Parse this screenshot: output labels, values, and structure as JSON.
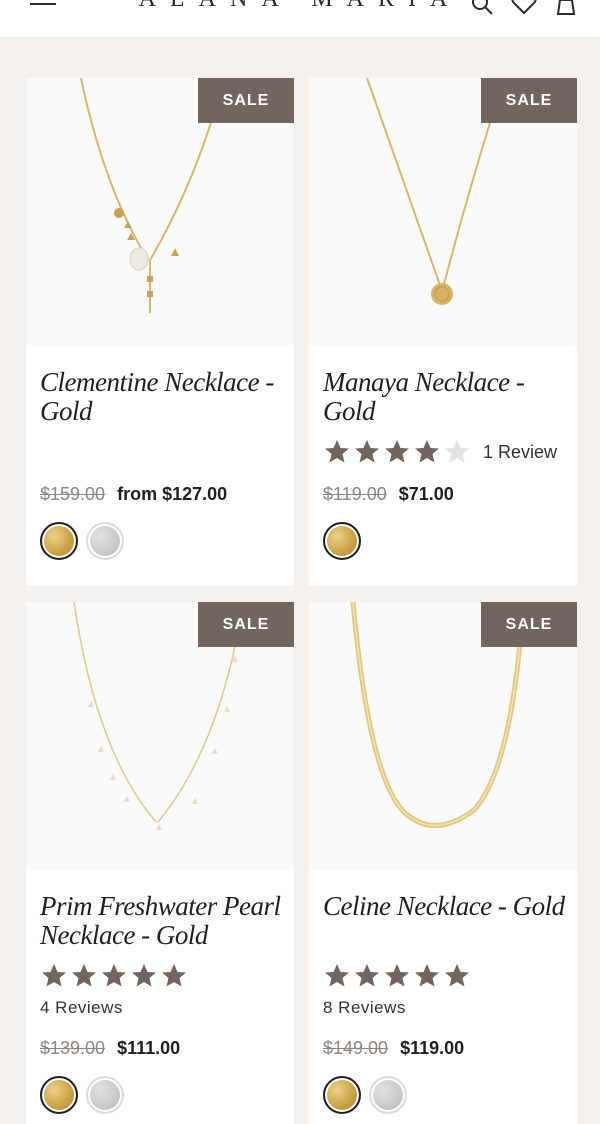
{
  "header": {
    "logo": "ALANA MARIA",
    "icons": [
      "menu-icon",
      "search-icon",
      "heart-icon",
      "bag-icon"
    ]
  },
  "colors": {
    "sale_badge": "#72645e",
    "star": "#72645e",
    "background": "#f6f1ed"
  },
  "products": [
    {
      "sale_label": "SALE",
      "title": "Clementine Necklace - Gold",
      "rating": null,
      "review_text": "",
      "old_price": "$159.00",
      "new_price": "from $127.00",
      "swatches": [
        "gold",
        "silver"
      ]
    },
    {
      "sale_label": "SALE",
      "title": "Manaya Necklace - Gold",
      "rating": 4,
      "review_text": "1 Review",
      "old_price": "$119.00",
      "new_price": "$71.00",
      "swatches": [
        "gold"
      ]
    },
    {
      "sale_label": "SALE",
      "title": "Prim Freshwater Pearl Necklace - Gold",
      "rating": 5,
      "review_text": "4 Reviews",
      "old_price": "$139.00",
      "new_price": "$111.00",
      "swatches": [
        "gold",
        "silver"
      ]
    },
    {
      "sale_label": "SALE",
      "title": "Celine Necklace - Gold",
      "rating": 5,
      "review_text": "8 Reviews",
      "old_price": "$149.00",
      "new_price": "$119.00",
      "swatches": [
        "gold",
        "silver"
      ]
    }
  ]
}
